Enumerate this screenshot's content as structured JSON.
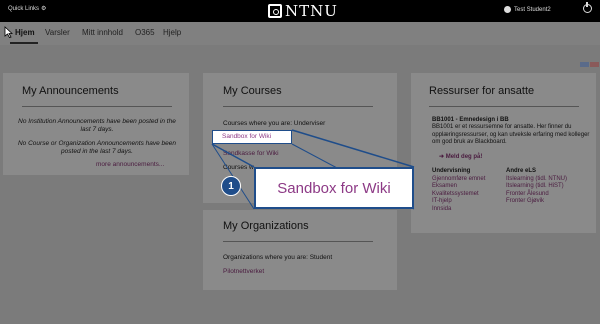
{
  "topbar": {
    "quick_links": "Quick Links",
    "logo_text": "NTNU",
    "user_name": "Test Student2"
  },
  "nav": {
    "tabs": [
      {
        "label": "Hjem"
      },
      {
        "label": "Varsler"
      },
      {
        "label": "Mitt innhold"
      },
      {
        "label": "O365"
      },
      {
        "label": "Hjelp"
      }
    ]
  },
  "announcements": {
    "title": "My Announcements",
    "line1": "No Institution Announcements have been posted in the last 7 days.",
    "line2": "No Course or Organization Announcements have been posted in the last 7 days.",
    "more": "more announcements..."
  },
  "courses": {
    "title": "My Courses",
    "role_line": "Courses where you are: Underviser",
    "items": [
      "Sandbox for Wiki",
      "Sandkasse for Wiki"
    ],
    "role_line2": "Courses w"
  },
  "organizations": {
    "title": "My Organizations",
    "role_line": "Organizations where you are: Student",
    "items": [
      "Pilotnettverket"
    ]
  },
  "resources": {
    "title": "Ressurser for ansatte",
    "heading": "BB1001 - Emnedesign i BB",
    "body": "BB1001 er et ressursemne for ansatte. Her finner du opplæringsressurser, og kan utveksle erfaring med kolleger om god bruk av Blackboard.",
    "signup": "Meld deg på!",
    "col1_title": "Undervisning",
    "col1_items": [
      "Gjennomføre emnet",
      "Eksamen",
      "Kvalitetssystemet",
      "IT-hjelp",
      "Innsida"
    ],
    "col2_title": "Andre eLS",
    "col2_items": [
      "Itslearning (tidl. NTNU)",
      "Itslearning (tidl. HiST)",
      "Fronter Ålesund",
      "Fronter Gjøvik"
    ]
  },
  "callout": {
    "number": "1",
    "text": "Sandbox for Wiki"
  },
  "colors": {
    "accent": "#1f4d8a",
    "link": "#8d3a86",
    "topbar": "#000000"
  }
}
